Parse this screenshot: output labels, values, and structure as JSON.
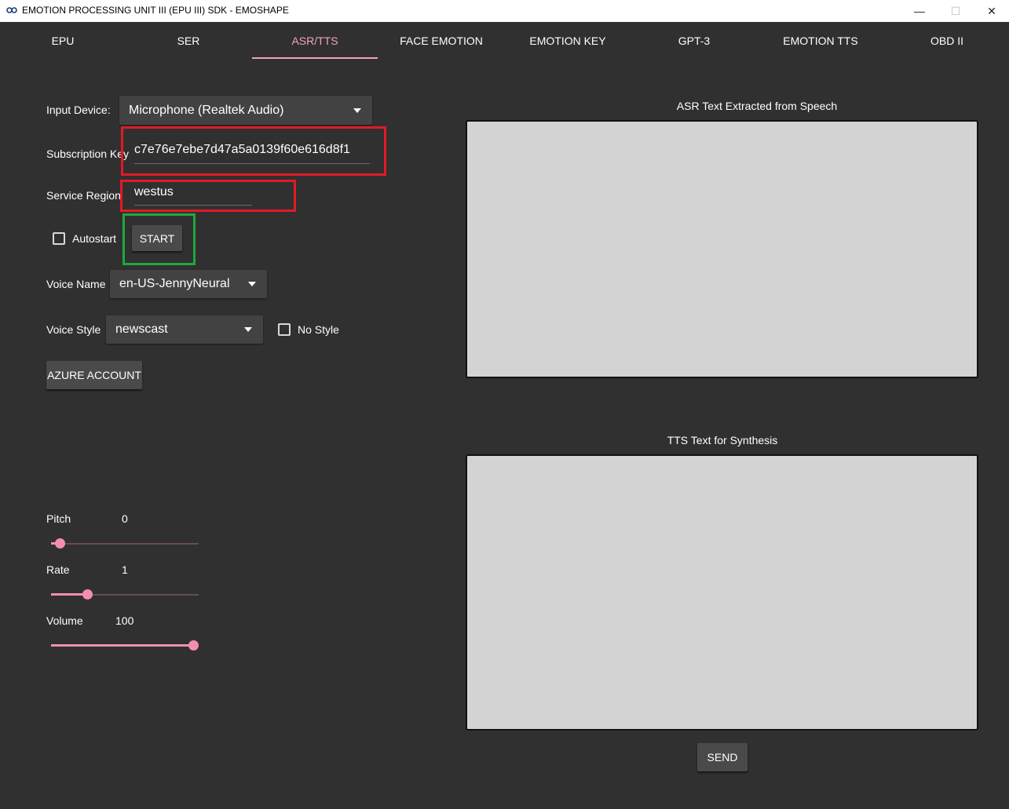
{
  "window": {
    "title": "EMOTION PROCESSING UNIT III (EPU III) SDK - EMOSHAPE",
    "controls": {
      "minimize": "—",
      "maximize": "☐",
      "close": "✕"
    }
  },
  "tabs": [
    {
      "label": "EPU",
      "active": false
    },
    {
      "label": "SER",
      "active": false
    },
    {
      "label": "ASR/TTS",
      "active": true
    },
    {
      "label": "FACE EMOTION",
      "active": false
    },
    {
      "label": "EMOTION KEY",
      "active": false
    },
    {
      "label": "GPT-3",
      "active": false
    },
    {
      "label": "EMOTION TTS",
      "active": false
    },
    {
      "label": "OBD II",
      "active": false
    }
  ],
  "form": {
    "input_device": {
      "label": "Input Device:",
      "value": "Microphone (Realtek Audio)"
    },
    "subscription_key": {
      "label": "Subscription Key",
      "value": "c7e76e7ebe7d47a5a0139f60e616d8f1"
    },
    "service_region": {
      "label": "Service Region",
      "value": "westus"
    },
    "autostart": {
      "label": "Autostart",
      "checked": false
    },
    "start_button": "START",
    "voice_name": {
      "label": "Voice Name",
      "value": "en-US-JennyNeural"
    },
    "voice_style": {
      "label": "Voice Style",
      "value": "newscast"
    },
    "no_style": {
      "label": "No Style",
      "checked": false
    },
    "azure_button": "AZURE ACCOUNT"
  },
  "sliders": {
    "pitch": {
      "label": "Pitch",
      "value": "0",
      "fraction": 0.03
    },
    "rate": {
      "label": "Rate",
      "value": "1",
      "fraction": 0.23
    },
    "volume": {
      "label": "Volume",
      "value": "100",
      "fraction": 1.0
    }
  },
  "asr": {
    "caption": "ASR Text Extracted from Speech",
    "text": ""
  },
  "tts": {
    "caption": "TTS Text for Synthesis",
    "text": "",
    "send_button": "SEND"
  },
  "colors": {
    "background": "#303030",
    "accent": "#f2a3be",
    "highlight_red": "#e11a25",
    "highlight_green": "#1ea83c",
    "text_area": "#d3d3d3"
  }
}
